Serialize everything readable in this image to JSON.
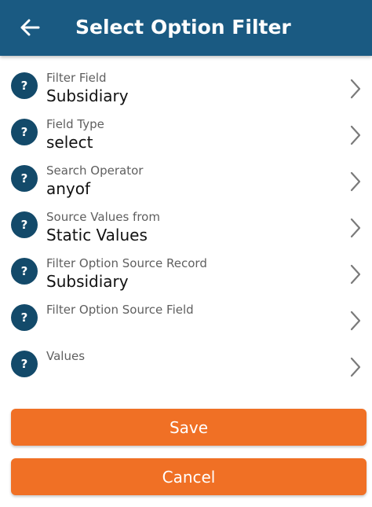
{
  "header": {
    "title": "Select Option Filter",
    "back_icon": "arrow-left-icon",
    "background_color": "#1a5a82"
  },
  "fields": [
    {
      "label": "Filter Field",
      "value": "Subsidiary"
    },
    {
      "label": "Field Type",
      "value": "select"
    },
    {
      "label": "Search Operator",
      "value": "anyof"
    },
    {
      "label": "Source Values from",
      "value": "Static Values"
    },
    {
      "label": "Filter Option Source Record",
      "value": "Subsidiary"
    },
    {
      "label": "Filter Option Source Field",
      "value": ""
    },
    {
      "label": "Values",
      "value": ""
    }
  ],
  "help_icon_glyph": "?",
  "actions": {
    "save_label": "Save",
    "cancel_label": "Cancel",
    "button_color": "#f07025"
  }
}
